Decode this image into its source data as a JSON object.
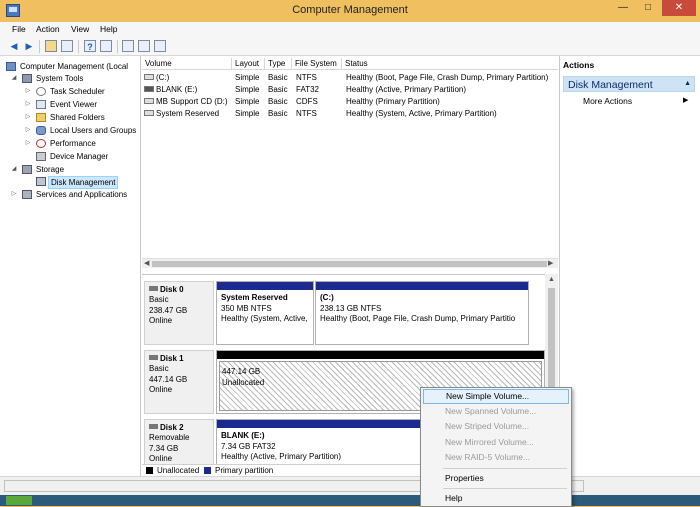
{
  "window": {
    "title": "Computer Management",
    "min_glyph": "—",
    "max_glyph": "□",
    "close_glyph": "✕"
  },
  "menu": [
    "File",
    "Action",
    "View",
    "Help"
  ],
  "tree": {
    "root": "Computer Management (Local",
    "system_tools": "System Tools",
    "task_scheduler": "Task Scheduler",
    "event_viewer": "Event Viewer",
    "shared_folders": "Shared Folders",
    "local_users": "Local Users and Groups",
    "performance": "Performance",
    "device_manager": "Device Manager",
    "storage": "Storage",
    "disk_management": "Disk Management",
    "services": "Services and Applications"
  },
  "volumes": {
    "headers": [
      "Volume",
      "Layout",
      "Type",
      "File System",
      "Status"
    ],
    "rows": [
      {
        "volume": "(C:)",
        "layout": "Simple",
        "type": "Basic",
        "fs": "NTFS",
        "status": "Healthy (Boot, Page File, Crash Dump, Primary Partition)"
      },
      {
        "volume": "BLANK (E:)",
        "layout": "Simple",
        "type": "Basic",
        "fs": "FAT32",
        "status": "Healthy (Active, Primary Partition)"
      },
      {
        "volume": "MB Support CD (D:)",
        "layout": "Simple",
        "type": "Basic",
        "fs": "CDFS",
        "status": "Healthy (Primary Partition)"
      },
      {
        "volume": "System Reserved",
        "layout": "Simple",
        "type": "Basic",
        "fs": "NTFS",
        "status": "Healthy (System, Active, Primary Partition)"
      }
    ]
  },
  "disks": {
    "disk0": {
      "name": "Disk 0",
      "type": "Basic",
      "size": "238.47 GB",
      "state": "Online",
      "p1": {
        "name": "System Reserved",
        "size": "350 MB NTFS",
        "status": "Healthy (System, Active,"
      },
      "p2": {
        "name": "(C:)",
        "size": "238.13 GB NTFS",
        "status": "Healthy (Boot, Page File, Crash Dump, Primary Partitio"
      }
    },
    "disk1": {
      "name": "Disk 1",
      "type": "Basic",
      "size": "447.14 GB",
      "state": "Online",
      "p1": {
        "size": "447.14 GB",
        "status": "Unallocated"
      }
    },
    "disk2": {
      "name": "Disk 2",
      "type": "Removable",
      "size": "7.34 GB",
      "state": "Online",
      "p1": {
        "name": "BLANK  (E:)",
        "size": "7.34 GB FAT32",
        "status": "Healthy (Active, Primary Partition)"
      }
    }
  },
  "legend": {
    "unallocated": "Unallocated",
    "primary": "Primary partition"
  },
  "actions": {
    "header": "Actions",
    "section": "Disk Management",
    "more": "More Actions"
  },
  "context_menu": {
    "new_simple": "New Simple Volume...",
    "new_spanned": "New Spanned Volume...",
    "new_striped": "New Striped Volume...",
    "new_mirrored": "New Mirrored Volume...",
    "new_raid5": "New RAID-5 Volume...",
    "properties": "Properties",
    "help": "Help"
  },
  "colors": {
    "title_bar": "#f0c060",
    "primary_partition": "#1b2a8f",
    "unallocated": "#000000",
    "selection": "#cce8ff"
  }
}
